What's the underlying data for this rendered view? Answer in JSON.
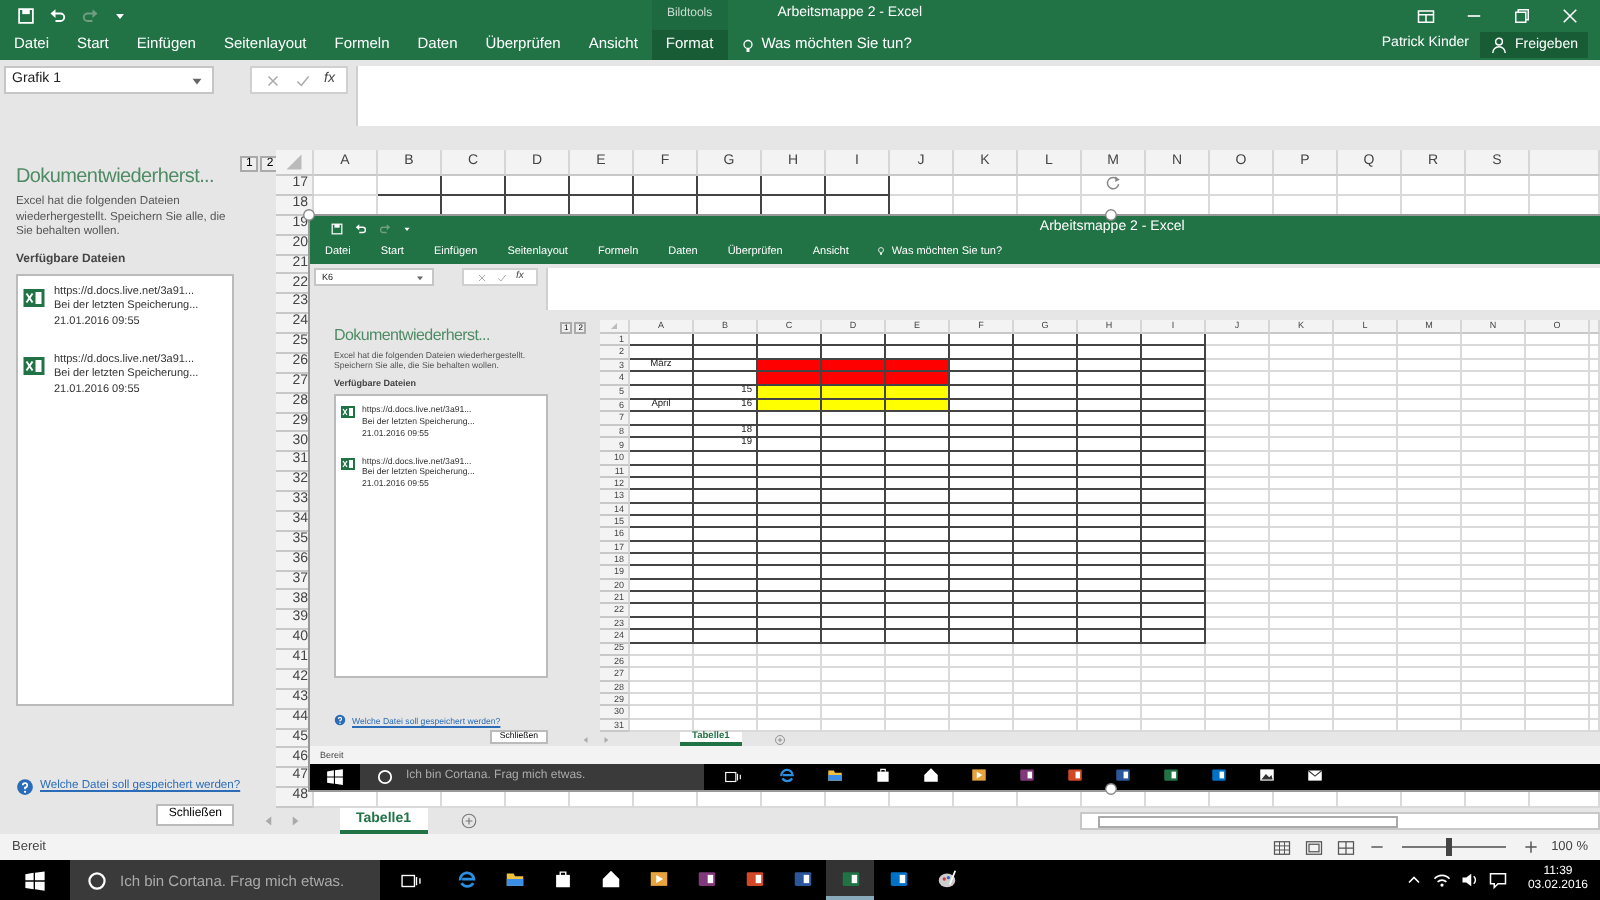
{
  "window": {
    "title": "Arbeitsmappe 2 - Excel"
  },
  "ribbon": {
    "tabs": [
      {
        "label": "Datei",
        "selected": false
      },
      {
        "label": "Start",
        "selected": false
      },
      {
        "label": "Einfügen",
        "selected": false
      },
      {
        "label": "Seitenlayout",
        "selected": false
      },
      {
        "label": "Formeln",
        "selected": false
      },
      {
        "label": "Daten",
        "selected": false
      },
      {
        "label": "Überprüfen",
        "selected": false
      },
      {
        "label": "Ansicht",
        "selected": false
      }
    ],
    "context_group": {
      "label": "Bildtools",
      "tabs": [
        {
          "label": "Format",
          "selected": true
        }
      ]
    },
    "tell_me": "Was möchten Sie tun?",
    "user": "Patrick Kinder",
    "share_button": "Freigeben"
  },
  "formula_bar": {
    "name_box": "Grafik 1",
    "insert_function": "fx"
  },
  "recovery_pane": {
    "title": "Dokumentwiederherst...",
    "description": "Excel hat die folgenden Dateien wiederhergestellt. Speichern Sie alle, die Sie behalten wollen.",
    "files_label": "Verfügbare Dateien",
    "files": [
      {
        "url": "https://d.docs.live.net/3a91...",
        "status": "Bei der letzten Speicherung...",
        "date": "21.01.2016 09:55"
      },
      {
        "url": "https://d.docs.live.net/3a91...",
        "status": "Bei der letzten Speicherung...",
        "date": "21.01.2016 09:55"
      }
    ],
    "help_link": "Welche Datei soll gespeichert werden?",
    "close_button": "Schließen"
  },
  "sheet": {
    "outline_levels": [
      "1",
      "2"
    ],
    "columns": [
      "A",
      "B",
      "C",
      "D",
      "E",
      "F",
      "G",
      "H",
      "I",
      "J",
      "K",
      "L",
      "M",
      "N",
      "O",
      "P",
      "Q",
      "R",
      "S"
    ],
    "rows": [
      "17",
      "18",
      "19",
      "20",
      "21",
      "22",
      "23",
      "24",
      "25",
      "26",
      "27",
      "28",
      "29",
      "30",
      "31",
      "32",
      "33",
      "34",
      "35",
      "36",
      "37",
      "38",
      "39",
      "40",
      "41",
      "42",
      "43",
      "44",
      "45",
      "46",
      "47",
      "48"
    ]
  },
  "pasted_screenshot": {
    "window": {
      "title": "Arbeitsmappe 2 - Excel"
    },
    "ribbon": {
      "tabs": [
        {
          "label": "Datei",
          "selected": false
        },
        {
          "label": "Start",
          "selected": false
        },
        {
          "label": "Einfügen",
          "selected": false
        },
        {
          "label": "Seitenlayout",
          "selected": false
        },
        {
          "label": "Formeln",
          "selected": false
        },
        {
          "label": "Daten",
          "selected": false
        },
        {
          "label": "Überprüfen",
          "selected": false
        },
        {
          "label": "Ansicht",
          "selected": false
        }
      ],
      "tell_me": "Was möchten Sie tun?"
    },
    "formula_bar": {
      "name_box": "K6",
      "insert_function": "fx"
    },
    "recovery_pane": {
      "title": "Dokumentwiederherst...",
      "description": "Excel hat die folgenden Dateien wiederhergestellt. Speichern Sie alle, die Sie behalten wollen.",
      "files_label": "Verfügbare Dateien",
      "files": [
        {
          "url": "https://d.docs.live.net/3a91...",
          "status": "Bei der letzten Speicherung...",
          "date": "21.01.2016 09:55"
        },
        {
          "url": "https://d.docs.live.net/3a91...",
          "status": "Bei der letzten Speicherung...",
          "date": "21.01.2016 09:55"
        }
      ],
      "help_link": "Welche Datei soll gespeichert werden?",
      "close_button": "Schließen"
    },
    "sheet": {
      "outline_levels": [
        "1",
        "2"
      ],
      "columns": [
        "A",
        "B",
        "C",
        "D",
        "E",
        "F",
        "G",
        "H",
        "I",
        "J",
        "K",
        "L",
        "M",
        "N",
        "O"
      ],
      "rows": [
        "1",
        "2",
        "3",
        "4",
        "5",
        "6",
        "7",
        "8",
        "9",
        "10",
        "11",
        "12",
        "13",
        "14",
        "15",
        "16",
        "17",
        "18",
        "19",
        "20",
        "21",
        "22",
        "23",
        "24",
        "25",
        "26",
        "27",
        "28",
        "29",
        "30",
        "31"
      ],
      "cells": [
        "März",
        "April",
        "15",
        "16",
        "18",
        "19"
      ],
      "fills": [
        {
          "color": "#ff0000"
        },
        {
          "color": "#ffff00"
        }
      ]
    },
    "sheet_tabs": [
      {
        "label": "Tabelle1",
        "selected": true
      }
    ],
    "status_bar": {
      "text": "Bereit"
    },
    "taskbar": {
      "search_placeholder": "Ich bin Cortana. Frag mich etwas.",
      "apps": [
        {
          "kind": "browser",
          "active": false
        },
        {
          "kind": "folder",
          "active": false
        },
        {
          "kind": "store",
          "active": false
        },
        {
          "kind": "home",
          "active": false
        },
        {
          "kind": "media",
          "active": false
        },
        {
          "kind": "notes",
          "active": false
        },
        {
          "kind": "slides",
          "active": false
        },
        {
          "kind": "document",
          "active": false
        },
        {
          "kind": "spreadsheet",
          "active": false
        },
        {
          "kind": "mail",
          "active": false
        },
        {
          "kind": "photos",
          "active": false
        },
        {
          "kind": "envelope",
          "active": false
        }
      ]
    }
  },
  "sheet_tabs": [
    {
      "label": "Tabelle1",
      "selected": true
    }
  ],
  "status_bar": {
    "text": "Bereit",
    "zoom": "100 %",
    "zoom_slider": {
      "level": 0.45
    }
  },
  "taskbar": {
    "search_placeholder": "Ich bin Cortana. Frag mich etwas.",
    "apps": [
      {
        "kind": "browser",
        "active": false
      },
      {
        "kind": "folder",
        "active": false
      },
      {
        "kind": "store",
        "active": false
      },
      {
        "kind": "home",
        "active": false
      },
      {
        "kind": "media",
        "active": false
      },
      {
        "kind": "notes",
        "active": false
      },
      {
        "kind": "slides",
        "active": false
      },
      {
        "kind": "document",
        "active": false
      },
      {
        "kind": "spreadsheet",
        "active": true
      },
      {
        "kind": "mail",
        "active": false
      },
      {
        "kind": "paint",
        "active": false
      }
    ],
    "time": "11:39",
    "date": "03.02.2016"
  }
}
